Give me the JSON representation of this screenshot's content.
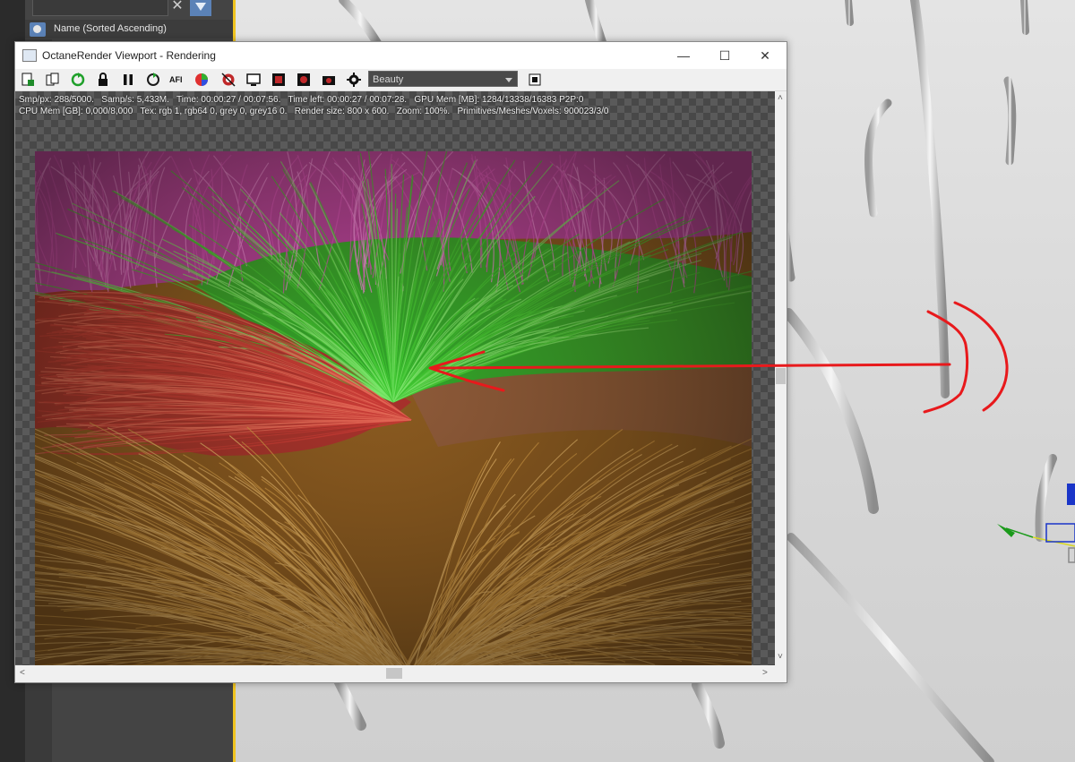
{
  "scene_explorer": {
    "sort_label": "Name (Sorted Ascending)",
    "clear_glyph": "✕"
  },
  "window": {
    "title": "OctaneRender Viewport - Rendering",
    "minimize_glyph": "—",
    "maximize_glyph": "☐",
    "close_glyph": "✕"
  },
  "toolbar": {
    "icons": [
      "save-render-icon",
      "copy-clipboard-icon",
      "restart-render-icon",
      "lock-icon",
      "pause-icon",
      "recompile-icon",
      "afi-icon",
      "color-picker-icon",
      "focus-picker-icon",
      "film-region-icon",
      "region-icon",
      "material-picker-icon",
      "camera-icon",
      "settings-gear-icon"
    ],
    "afi_text": "AFI",
    "render_pass": "Beauty"
  },
  "stats": {
    "line1": "Smp/px: 288/5000.   Samp/s: 5,433M.   Time: 00:00:27 / 00:07:56.   Time left: 00:00:27 / 00:07:28.   GPU Mem [MB]: 1284/13338/16383 P2P:0",
    "line2": "CPU Mem [GB]: 0,000/8,000   Tex: rgb 1, rgb64 0, grey 0, grey16 0.   Render size: 800 x 600.   Zoom: 100%.   Primitives/Meshes/Voxels: 900023/3/0"
  },
  "colors": {
    "annotation": "#e8191c",
    "max_accent": "#f0c420",
    "grass_pink": "#d94fc0",
    "grass_green": "#3fcb33",
    "grass_red": "#c83a35",
    "grass_orange": "#d8a048"
  },
  "scrollbars": {
    "up_arrow": "˄",
    "down_arrow": "˅",
    "left_arrow": "<",
    "right_arrow": ">"
  }
}
